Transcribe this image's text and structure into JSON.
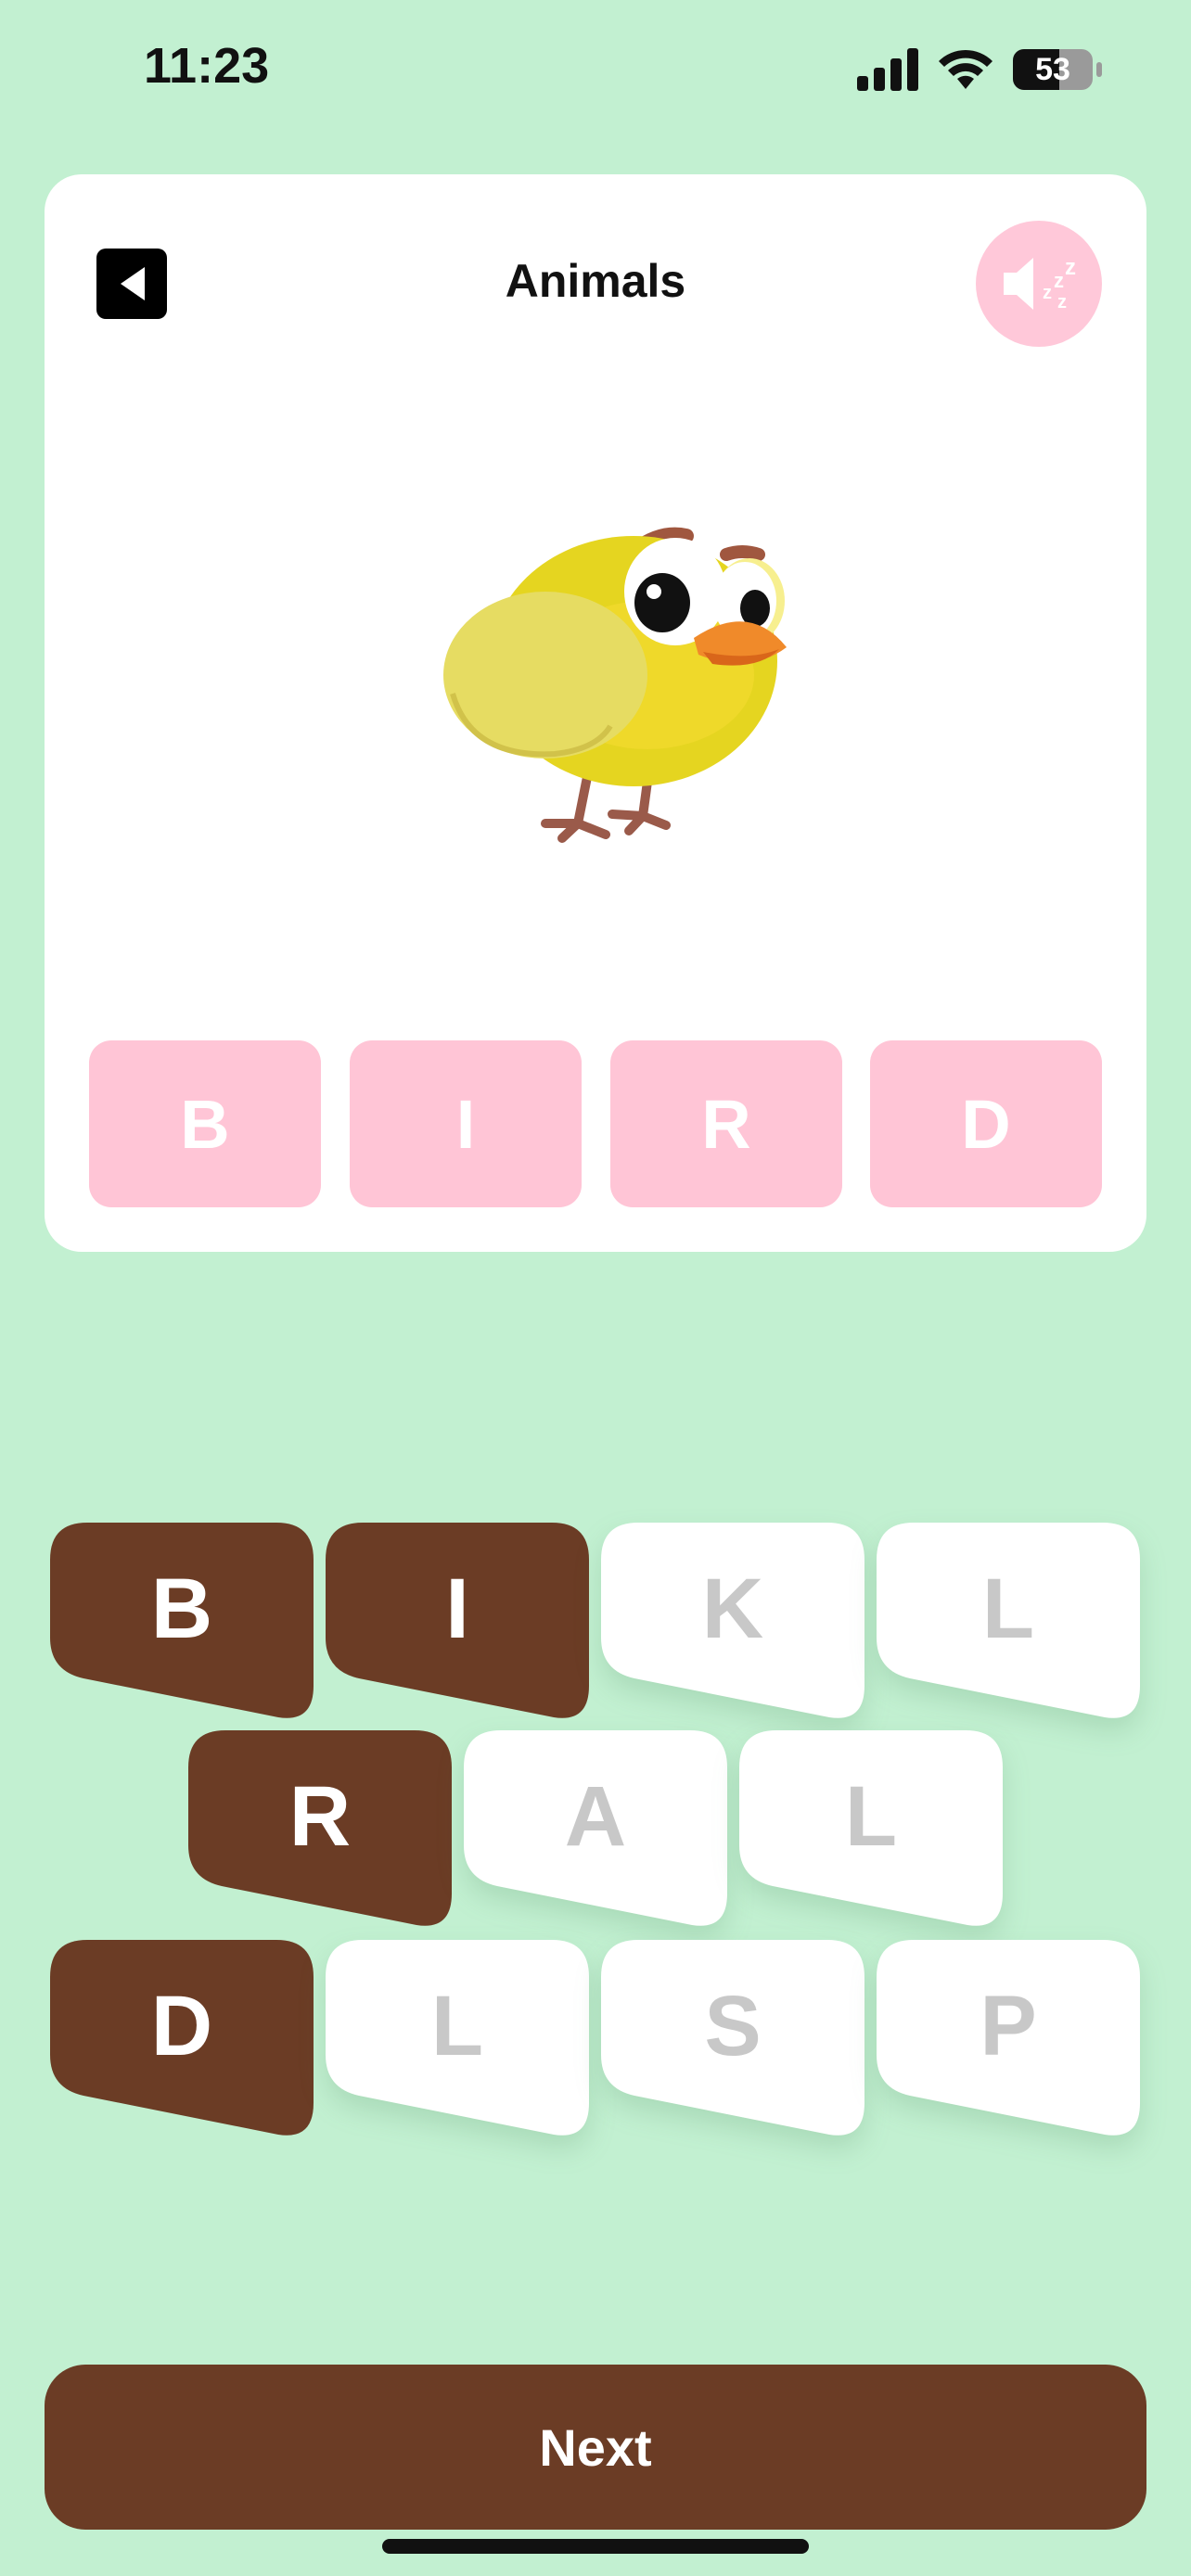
{
  "status_bar": {
    "time": "11:23",
    "battery": "53"
  },
  "card": {
    "title": "Animals",
    "sound_icon": "muted-speaker-icon",
    "image": "cartoon-yellow-bird"
  },
  "answer": {
    "letters": [
      "B",
      "I",
      "R",
      "D"
    ]
  },
  "keyboard": {
    "rows": [
      [
        {
          "letter": "B",
          "selected": true
        },
        {
          "letter": "I",
          "selected": true
        },
        {
          "letter": "K",
          "selected": false
        },
        {
          "letter": "L",
          "selected": false
        }
      ],
      [
        {
          "letter": "R",
          "selected": true
        },
        {
          "letter": "A",
          "selected": false
        },
        {
          "letter": "L",
          "selected": false
        }
      ],
      [
        {
          "letter": "D",
          "selected": true
        },
        {
          "letter": "L",
          "selected": false
        },
        {
          "letter": "S",
          "selected": false
        },
        {
          "letter": "P",
          "selected": false
        }
      ]
    ]
  },
  "next_button": {
    "label": "Next"
  },
  "colors": {
    "background": "#c2f0d1",
    "tile_selected": "#6b3c25",
    "tile_unselected": "#ffffff",
    "answer_slot": "#ffc5d6"
  }
}
